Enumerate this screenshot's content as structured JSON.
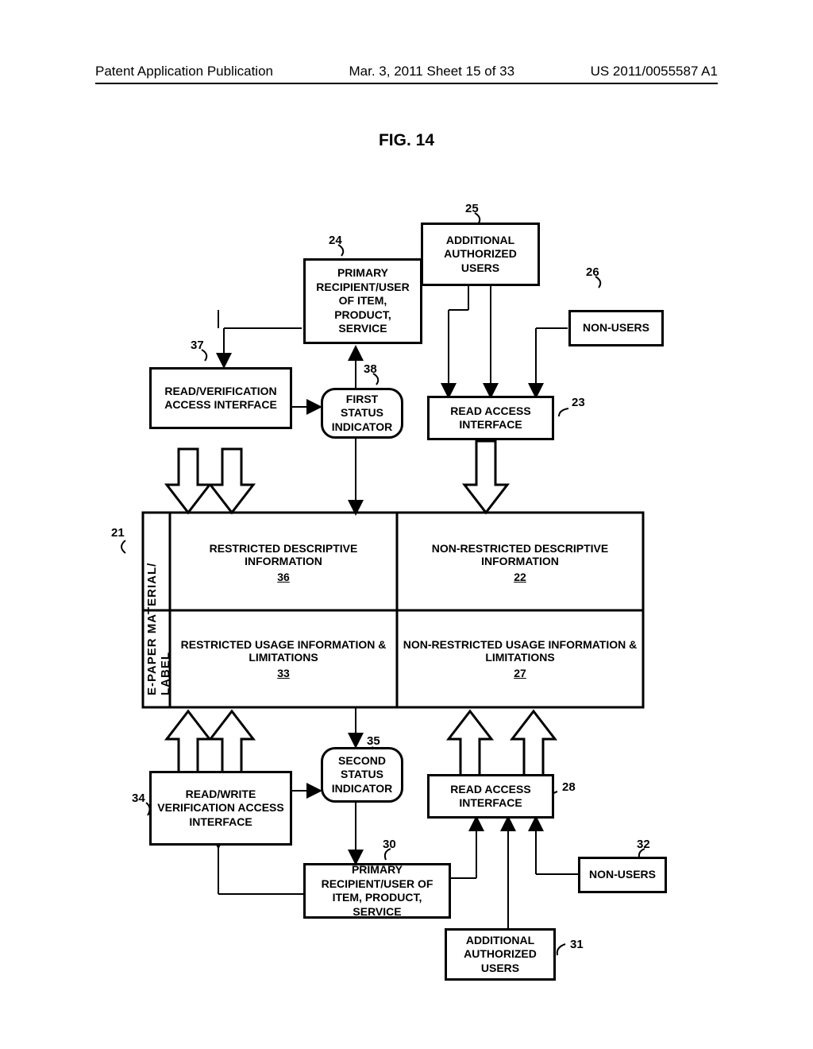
{
  "header": {
    "left": "Patent Application Publication",
    "mid": "Mar. 3, 2011  Sheet 15 of 33",
    "right": "US 2011/0055587 A1"
  },
  "figure_title": "FIG. 14",
  "refs": {
    "r21": "21",
    "r22": "22",
    "r23": "23",
    "r24": "24",
    "r25": "25",
    "r26": "26",
    "r27": "27",
    "r28": "28",
    "r30": "30",
    "r31": "31",
    "r32": "32",
    "r33": "33",
    "r34": "34",
    "r35": "35",
    "r36": "36",
    "r37": "37",
    "r38": "38"
  },
  "boxes": {
    "additional_auth_top": "ADDITIONAL AUTHORIZED USERS",
    "primary_top": "PRIMARY RECIPIENT/USER OF ITEM, PRODUCT, SERVICE",
    "nonusers_top": "NON-USERS",
    "read_verif": "READ/VERIFICATION ACCESS INTERFACE",
    "first_status": "FIRST STATUS INDICATOR",
    "read_access_top": "READ ACCESS INTERFACE",
    "restricted_desc": "RESTRICTED DESCRIPTIVE INFORMATION",
    "nonrestricted_desc": "NON-RESTRICTED DESCRIPTIVE INFORMATION",
    "restricted_usage": "RESTRICTED USAGE INFORMATION & LIMITATIONS",
    "nonrestricted_usage": "NON-RESTRICTED USAGE INFORMATION & LIMITATIONS",
    "second_status": "SECOND STATUS INDICATOR",
    "read_access_bottom": "READ ACCESS INTERFACE",
    "rw_verif": "READ/WRITE VERIFICATION ACCESS INTERFACE",
    "primary_bottom": "PRIMARY RECIPIENT/USER OF ITEM, PRODUCT, SERVICE",
    "nonusers_bottom": "NON-USERS",
    "additional_auth_bottom": "ADDITIONAL AUTHORIZED USERS",
    "epaper_label": "E-PAPER MATERIAL/ LABEL"
  }
}
